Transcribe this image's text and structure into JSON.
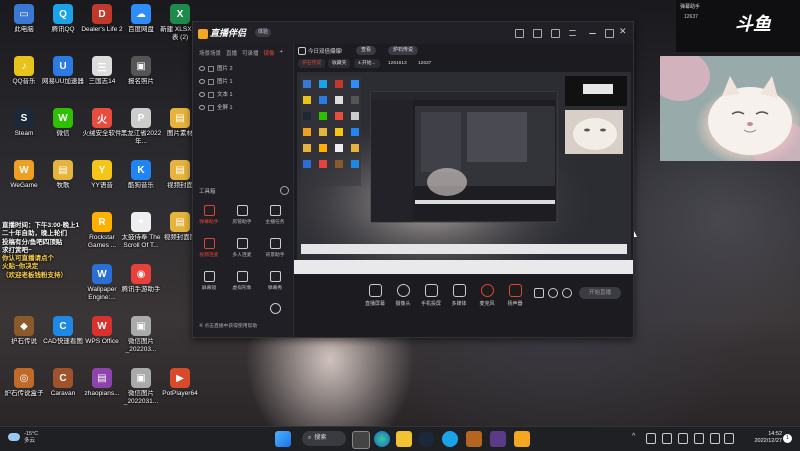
{
  "desktop_icons": [
    {
      "label": "此电脑",
      "color": "#3a78d4",
      "glyph": "▭"
    },
    {
      "label": "腾讯QQ",
      "color": "#1aa3e8",
      "glyph": "Q"
    },
    {
      "label": "Dealer's Life 2",
      "color": "#c0392b",
      "glyph": "D"
    },
    {
      "label": "百度网盘",
      "color": "#2f8df7",
      "glyph": "☁"
    },
    {
      "label": "新建 XLSX 作表 (2)",
      "color": "#1f8a4c",
      "glyph": "X"
    },
    {
      "label": "QQ音乐",
      "color": "#e8c31b",
      "glyph": "♪"
    },
    {
      "label": "网易UU加速器",
      "color": "#2c7be5",
      "glyph": "U"
    },
    {
      "label": "三国志14",
      "color": "#ddd",
      "glyph": "三"
    },
    {
      "label": "报名照片",
      "color": "#555",
      "glyph": "▣"
    },
    {
      "label": "Steam",
      "color": "#1b2838",
      "glyph": "S"
    },
    {
      "label": "微信",
      "color": "#2dc100",
      "glyph": "W"
    },
    {
      "label": "火绒安全软件",
      "color": "#e84c3d",
      "glyph": "火"
    },
    {
      "label": "黑龙江省2022年...",
      "color": "#ccc",
      "glyph": "P"
    },
    {
      "label": "图片素材",
      "color": "#e6b33c",
      "glyph": "▤"
    },
    {
      "label": "WeGame",
      "color": "#f0a020",
      "glyph": "W"
    },
    {
      "label": "牧歌",
      "color": "#e6b33c",
      "glyph": "▤"
    },
    {
      "label": "YY语音",
      "color": "#f5c518",
      "glyph": "Y"
    },
    {
      "label": "酷狗音乐",
      "color": "#2184f3",
      "glyph": "K"
    },
    {
      "label": "视频封面",
      "color": "#e6b33c",
      "glyph": "▤"
    },
    {
      "label": "Rockstar Games ...",
      "color": "#ffb000",
      "glyph": "R"
    },
    {
      "label": "太鼓侍奉 The Scroll Of T...",
      "color": "#eee",
      "glyph": "✶"
    },
    {
      "label": "视频封面图",
      "color": "#e6b33c",
      "glyph": "▤"
    },
    {
      "label": "Wallpaper Engine:...",
      "color": "#2a6fd6",
      "glyph": "W"
    },
    {
      "label": "腾讯手游助手",
      "color": "#e8403a",
      "glyph": "◉"
    },
    {
      "label": "护石传说",
      "color": "#8a5a2a",
      "glyph": "◆"
    },
    {
      "label": "CAD快速看图",
      "color": "#1e88e5",
      "glyph": "C"
    },
    {
      "label": "WPS Office",
      "color": "#d9312c",
      "glyph": "W"
    },
    {
      "label": "微信图片_202203...",
      "color": "#aaa",
      "glyph": "▣"
    },
    {
      "label": "炉石传说盒子",
      "color": "#c06a2a",
      "glyph": "◎"
    },
    {
      "label": "Caravan",
      "color": "#a0522d",
      "glyph": "C"
    },
    {
      "label": "zhaopians...",
      "color": "#8e44ad",
      "glyph": "▤"
    },
    {
      "label": "微信图片_2022031...",
      "color": "#aaa",
      "glyph": "▣"
    },
    {
      "label": "PotPlayer64",
      "color": "#d84a2a",
      "glyph": "▶"
    }
  ],
  "overlay_text": {
    "line1": "直播时间：下午3:00-晚上1",
    "line2": "二十年自助，晚上轮们",
    "line3": "投稿有分/鱼吧四顶贴",
    "line4": "求打赏吧~",
    "line5": "你认可直播请点个",
    "line6": "火贴~你决定",
    "line7": "（欢迎老板钱粉支持）"
  },
  "streamer_app": {
    "name": "直播伴侣",
    "version_badge": "体验",
    "left_tabs": [
      "场景场景",
      "直播",
      "可录播",
      "镜像",
      "+"
    ],
    "active_tab_index": 3,
    "scenes": [
      "图片 2",
      "图片 1",
      "文本 1",
      "全屏 1"
    ],
    "tools_label": "工具箱",
    "tools": [
      "弹幕助手",
      "房管助手",
      "主播任务",
      "视频连麦",
      "多人连麦",
      "背景助手",
      "屏幕镜",
      "虚拟形象",
      "弹幕秀",
      "更多"
    ],
    "tip": "※ 点击直播中获得使用帮助",
    "notice": "今日双倍爆爆!",
    "notice_btns": [
      "查看",
      "炉石传说"
    ],
    "top_chips": [
      "炉石传说",
      "收藏夹",
      "4.开始...",
      "1261613",
      "12637"
    ],
    "bottom_controls": [
      "直播屏幕",
      "摄像头",
      "手机投屏",
      "多媒体",
      "麦克风",
      "扬声器"
    ],
    "go_live_label": "开始直播"
  },
  "right_widget": {
    "title": "弹幕助手",
    "count": "12637",
    "brand": "斗鱼"
  },
  "taskbar": {
    "temperature": "-15°C",
    "weather_desc": "多云",
    "search_label": "搜索",
    "time": "14:52",
    "date": "2022/12/27",
    "notif_count": "1"
  }
}
